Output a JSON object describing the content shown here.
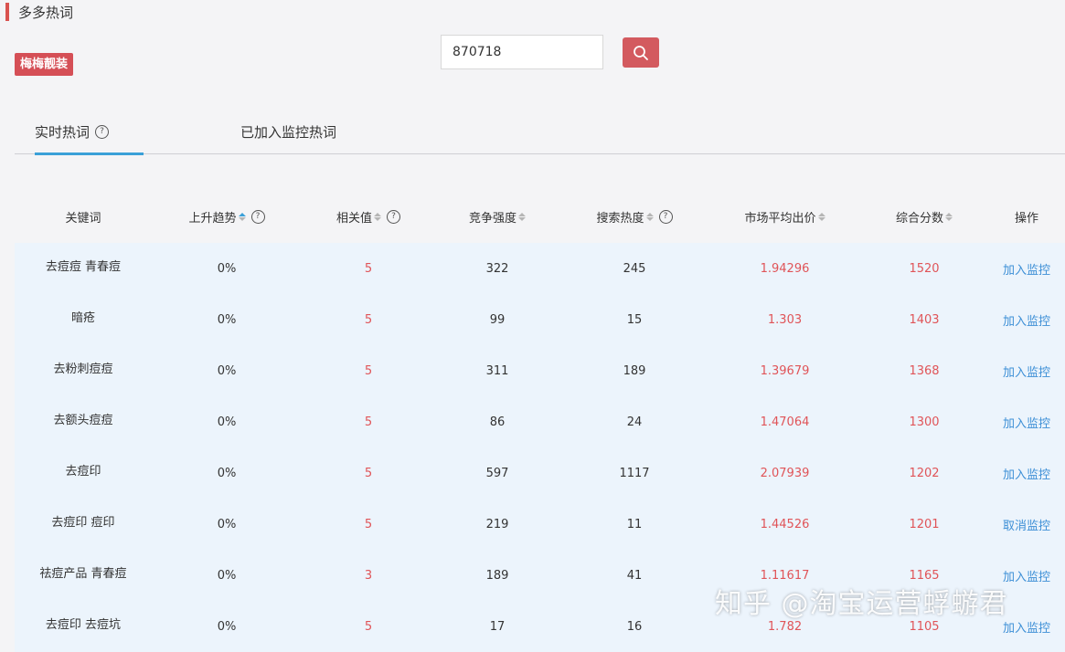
{
  "page": {
    "title": "多多热词"
  },
  "shop": {
    "badge": "梅梅靓装"
  },
  "search": {
    "value": "870718",
    "button_icon": "search-icon"
  },
  "tabs": [
    {
      "label": "实时热词",
      "active": true,
      "help": "?"
    },
    {
      "label": "已加入监控热词",
      "active": false
    }
  ],
  "table": {
    "headers": [
      "关键词",
      "上升趋势",
      "相关值",
      "竞争强度",
      "搜索热度",
      "市场平均出价",
      "综合分数",
      "操作"
    ],
    "rows": [
      {
        "keyword": "去痘痘 青春痘",
        "trend": "0%",
        "relevance": "5",
        "competition": "322",
        "heat": "245",
        "avg_bid": "1.94296",
        "score": "1520",
        "action": "加入监控"
      },
      {
        "keyword": "暗疮",
        "trend": "0%",
        "relevance": "5",
        "competition": "99",
        "heat": "15",
        "avg_bid": "1.303",
        "score": "1403",
        "action": "加入监控"
      },
      {
        "keyword": "去粉刺痘痘",
        "trend": "0%",
        "relevance": "5",
        "competition": "311",
        "heat": "189",
        "avg_bid": "1.39679",
        "score": "1368",
        "action": "加入监控"
      },
      {
        "keyword": "去额头痘痘",
        "trend": "0%",
        "relevance": "5",
        "competition": "86",
        "heat": "24",
        "avg_bid": "1.47064",
        "score": "1300",
        "action": "加入监控"
      },
      {
        "keyword": "去痘印",
        "trend": "0%",
        "relevance": "5",
        "competition": "597",
        "heat": "1117",
        "avg_bid": "2.07939",
        "score": "1202",
        "action": "加入监控"
      },
      {
        "keyword": "去痘印 痘印",
        "trend": "0%",
        "relevance": "5",
        "competition": "219",
        "heat": "11",
        "avg_bid": "1.44526",
        "score": "1201",
        "action": "取消监控"
      },
      {
        "keyword": "祛痘产品 青春痘",
        "trend": "0%",
        "relevance": "3",
        "competition": "189",
        "heat": "41",
        "avg_bid": "1.11617",
        "score": "1165",
        "action": "加入监控"
      },
      {
        "keyword": "去痘印 去痘坑",
        "trend": "0%",
        "relevance": "5",
        "competition": "17",
        "heat": "16",
        "avg_bid": "1.782",
        "score": "1105",
        "action": "加入监控"
      }
    ]
  },
  "watermark": {
    "text": "知乎 @淘宝运营蜉蝣君"
  },
  "colors": {
    "accent_red": "#d54f56",
    "value_red": "#e05458",
    "link_blue": "#3d8fd6",
    "tab_blue": "#3aa0d8"
  }
}
